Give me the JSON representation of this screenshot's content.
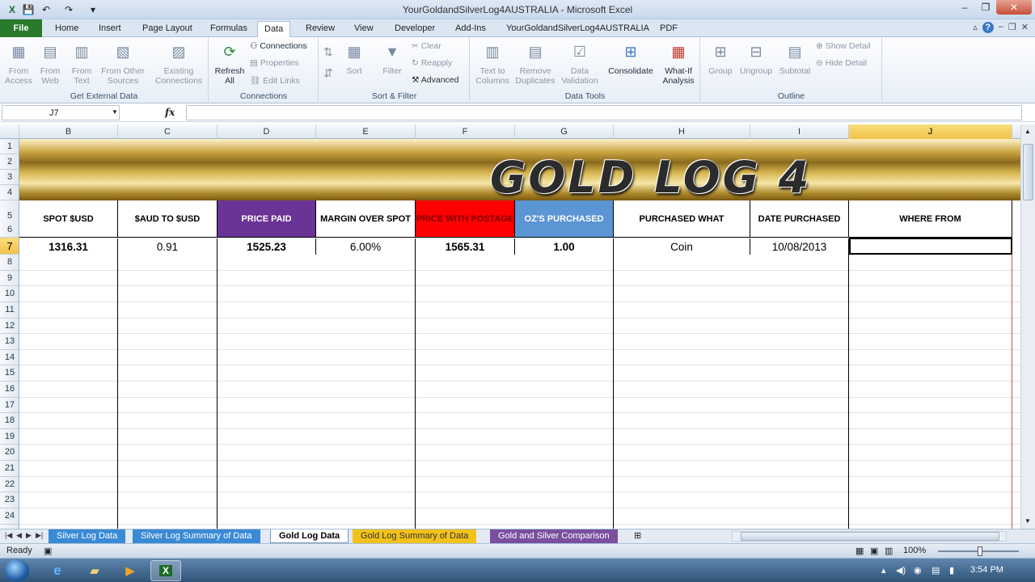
{
  "window": {
    "title": "YourGoldandSilverLog4AUSTRALIA  -  Microsoft Excel",
    "controls": {
      "minimize": "–",
      "restore": "❐",
      "close": "✕"
    }
  },
  "qat": {
    "excel_icon": "X",
    "save_icon": "💾",
    "undo_icon": "↶",
    "redo_icon": "↷",
    "customize_icon": "▾"
  },
  "tabs": [
    "File",
    "Home",
    "Insert",
    "Page Layout",
    "Formulas",
    "Data",
    "Review",
    "View",
    "Developer",
    "Add-Ins",
    "YourGoldandSilverLog4AUSTRALIA",
    "PDF"
  ],
  "active_tab": "Data",
  "tab_icons": {
    "minimize_ribbon": "▵",
    "help": "?",
    "doc_min": "–",
    "doc_restore": "❐",
    "doc_close": "✕"
  },
  "ribbon": {
    "get_external_data": {
      "label": "Get External Data",
      "buttons": [
        "From Access",
        "From Web",
        "From Text",
        "From Other Sources",
        "Existing Connections"
      ]
    },
    "connections": {
      "label": "Connections",
      "refresh": "Refresh All",
      "items": [
        "Connections",
        "Properties",
        "Edit Links"
      ]
    },
    "sort_filter": {
      "label": "Sort & Filter",
      "sort": "Sort",
      "filter": "Filter",
      "items": [
        "Clear",
        "Reapply",
        "Advanced"
      ]
    },
    "data_tools": {
      "label": "Data Tools",
      "buttons": [
        "Text to Columns",
        "Remove Duplicates",
        "Data Validation",
        "Consolidate",
        "What-If Analysis"
      ]
    },
    "outline": {
      "label": "Outline",
      "buttons": [
        "Group",
        "Ungroup",
        "Subtotal"
      ],
      "items": [
        "Show Detail",
        "Hide Detail"
      ]
    }
  },
  "formula_bar": {
    "name_box": "J7",
    "fx": "fx",
    "formula": ""
  },
  "columns": [
    "B",
    "C",
    "D",
    "E",
    "F",
    "G",
    "H",
    "I",
    "J"
  ],
  "selected_column": "J",
  "rows": [
    "1",
    "2",
    "3",
    "4",
    "5",
    "6",
    "7",
    "8",
    "9",
    "10",
    "11",
    "12",
    "13",
    "14",
    "15",
    "16",
    "17",
    "18",
    "19",
    "20",
    "21",
    "22",
    "23",
    "24"
  ],
  "selected_row": "7",
  "banner_title": "GOLD LOG 4",
  "headers": [
    "SPOT $USD",
    "$AUD TO $USD",
    "PRICE PAID",
    "MARGIN OVER SPOT",
    "PRICE WITH POSTAGE",
    "OZ'S PURCHASED",
    "PURCHASED WHAT",
    "DATE PURCHASED",
    "WHERE FROM"
  ],
  "header_colors": {
    "PRICE PAID": "#6a3396",
    "PRICE WITH POSTAGE": "#ff0000",
    "OZ'S PURCHASED": "#5b95d4"
  },
  "row7": [
    "1316.31",
    "0.91",
    "1525.23",
    "6.00%",
    "1565.31",
    "1.00",
    "Coin",
    "10/08/2013",
    ""
  ],
  "sheet_tabs": [
    {
      "label": "Silver Log Data",
      "color": "#3a8ad4"
    },
    {
      "label": "Silver Log Summary of Data",
      "color": "#3a8ad4"
    },
    {
      "label": "Gold Log Data",
      "color": "#ffffff"
    },
    {
      "label": "Gold Log Summary of Data",
      "color": "#f2c21b"
    },
    {
      "label": "Gold and Silver Comparison",
      "color": "#7b4fa0"
    }
  ],
  "active_sheet": "Gold Log Data",
  "status": {
    "text": "Ready",
    "zoom": "100%"
  },
  "taskbar": {
    "time": "3:54 PM"
  }
}
